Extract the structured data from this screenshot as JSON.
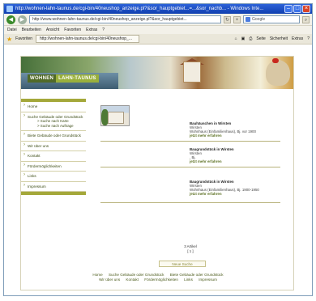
{
  "browser": {
    "title": "http://wohnen-lahn-taunus.de/cgi-bin/40neushop_anzeige.pl?&sor_hauptgebiet...=...&sor_nachb... - Windows Inte...",
    "address": "http://www.wohnen-lahn-taunus.de/cgi-bin/40neushop_anzeige.pl?&sor_hauptgebiet...",
    "search_placeholder": "Google",
    "menu": [
      "Datei",
      "Bearbeiten",
      "Ansicht",
      "Favoriten",
      "Extras",
      "?"
    ],
    "favorites_label": "Favoriten",
    "tab_label": "http://wohnen-lahn-taunus.de/cgi-bin/40neushop_...",
    "toolbar": [
      "Seite",
      "Sicherheit",
      "Extras"
    ]
  },
  "site": {
    "logo_left": "WOHNEN",
    "logo_right": "LAHN-TAUNUS",
    "nav": [
      {
        "label": "Home",
        "subs": []
      },
      {
        "label": "Suche Gebäude oder Grundstück",
        "subs": [
          "> Suche nach Karte",
          "> Suche nach Auftrage"
        ]
      },
      {
        "label": "Biete Gebäude oder Grundstück",
        "subs": []
      },
      {
        "label": "Wir über uns",
        "subs": []
      },
      {
        "label": "Kontakt",
        "subs": []
      },
      {
        "label": "Fördermöglichkeiten",
        "subs": []
      },
      {
        "label": "Links",
        "subs": []
      },
      {
        "label": "Impressum",
        "subs": []
      }
    ],
    "listings": [
      {
        "title": "Bauhäuschen in Wirsten",
        "lines": [
          "Wirsten",
          "Wohnhaus (Einfamilienhaus), Bj. vor 1900"
        ],
        "more": "jetzt mehr erfahren"
      },
      {
        "title": "Baugrundstück in Wirsten",
        "lines": [
          "Wirsten",
          ", Bj."
        ],
        "more": "jetzt mehr erfahren"
      },
      {
        "title": "Baugrundstück in Wirsten",
        "lines": [
          "Wirsten",
          "Wohnhaus (Einfamilienhaus), Bj. 1900-1950"
        ],
        "more": "jetzt mehr erfahren"
      }
    ],
    "pager_count": "3 Artikel",
    "pager_page": "[ 1 ]",
    "new_search": "Neue Suche",
    "footer_row1": [
      "Home",
      "Suche Gebäude oder Grundstück",
      "Biete Gebäude oder Grundstück"
    ],
    "footer_row2": [
      "Wir über uns",
      "Kontakt",
      "Fördermöglichkeiten",
      "Links",
      "Impressum"
    ]
  }
}
